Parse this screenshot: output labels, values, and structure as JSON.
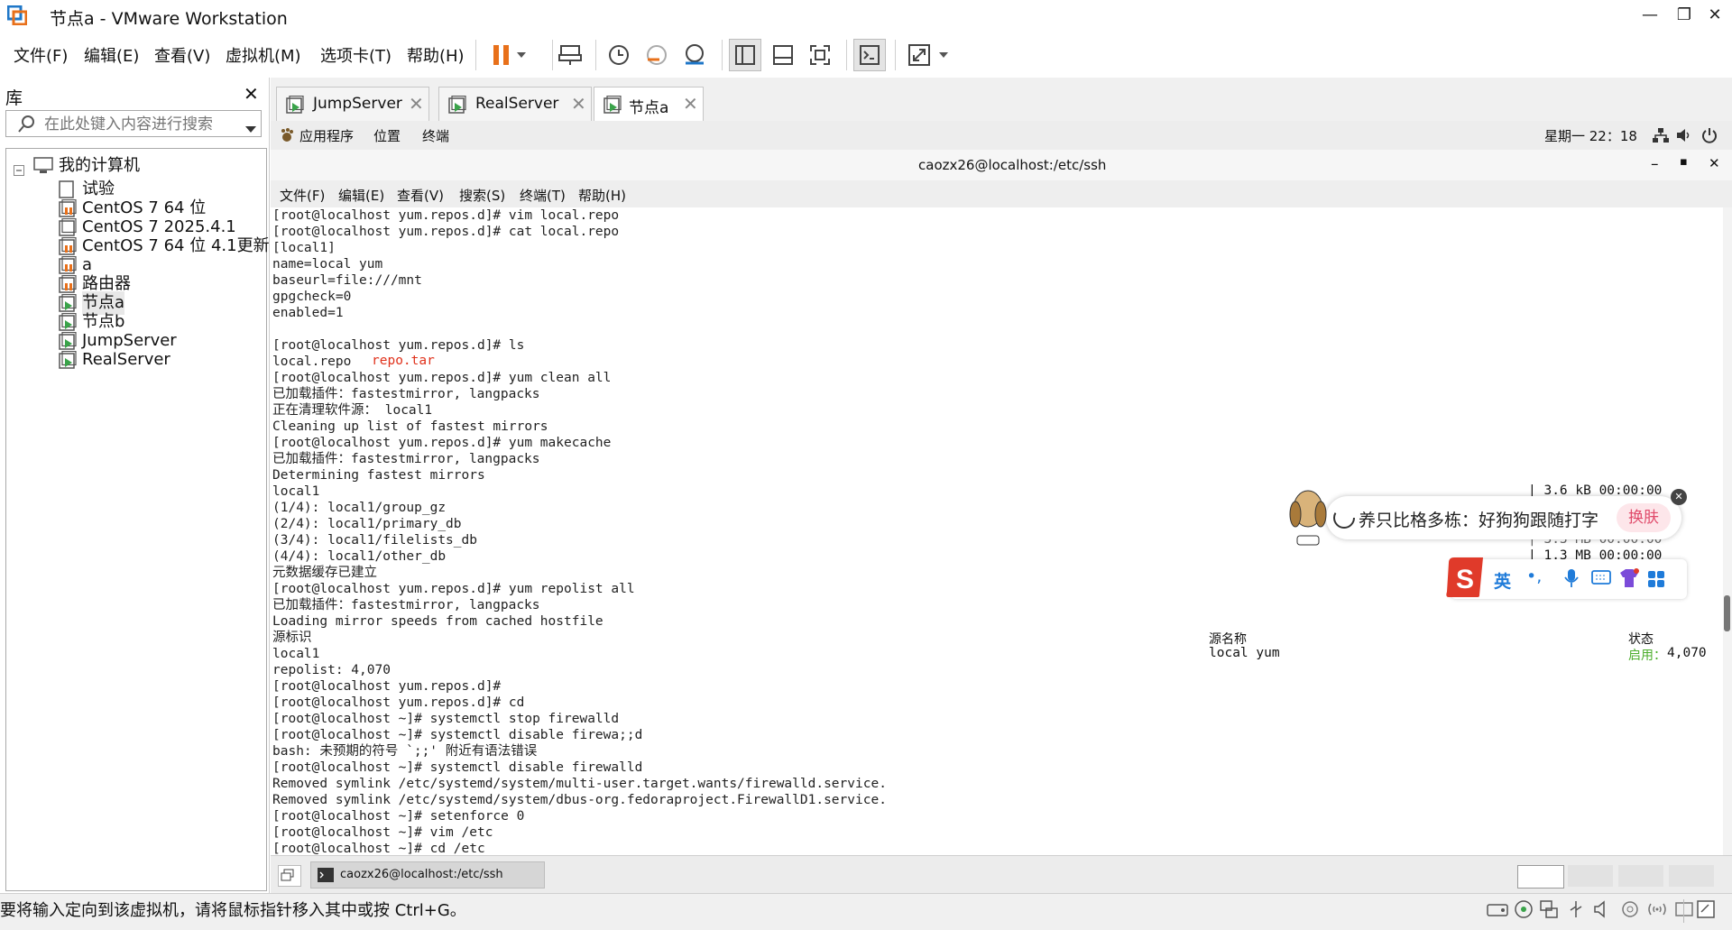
{
  "window": {
    "title": "节点a - VMware Workstation",
    "controls": [
      "—",
      "❐",
      "✕"
    ]
  },
  "menubar": {
    "items": [
      "文件(F)",
      "编辑(E)",
      "查看(V)",
      "虚拟机(M)",
      "选项卡(T)",
      "帮助(H)"
    ]
  },
  "library": {
    "title": "库",
    "close": "✕",
    "search_placeholder": "在此处键入内容进行搜索",
    "tree": {
      "root": "我的计算机",
      "items": [
        "试验",
        "CentOS 7 64 位",
        "CentOS 7 2025.4.1",
        "CentOS 7 64 位 4.1更新",
        "a",
        "路由器",
        "节点a",
        "节点b",
        "JumpServer",
        "RealServer"
      ]
    }
  },
  "tabs": [
    {
      "label": "JumpServer",
      "active": false
    },
    {
      "label": "RealServer",
      "active": false
    },
    {
      "label": "节点a",
      "active": true
    }
  ],
  "guest_topbar": {
    "apps": "应用程序",
    "places": "位置",
    "terminal": "终端",
    "clock": "星期一 22：18"
  },
  "terminal": {
    "title": "caozx26@localhost:/etc/ssh",
    "controls": [
      "–",
      "▪",
      "✕"
    ],
    "menu": [
      "文件(F)",
      "编辑(E)",
      "查看(V)",
      "搜索(S)",
      "终端(T)",
      "帮助(H)"
    ],
    "lines": [
      "[root@localhost yum.repos.d]# vim local.repo",
      "[root@localhost yum.repos.d]# cat local.repo",
      "[local1]",
      "name=local yum",
      "baseurl=file:///mnt",
      "gpgcheck=0",
      "enabled=1",
      "",
      "[root@localhost yum.repos.d]# ls",
      "local.repo",
      "[root@localhost yum.repos.d]# yum clean all",
      "已加载插件：fastestmirror, langpacks",
      "正在清理软件源： local1",
      "Cleaning up list of fastest mirrors",
      "[root@localhost yum.repos.d]# yum makecache",
      "已加载插件：fastestmirror, langpacks",
      "Determining fastest mirrors",
      "local1",
      "(1/4): local1/group_gz",
      "(2/4): local1/primary_db",
      "(3/4): local1/filelists_db",
      "(4/4): local1/other_db",
      "元数据缓存已建立",
      "[root@localhost yum.repos.d]# yum repolist all",
      "已加载插件：fastestmirror, langpacks",
      "Loading mirror speeds from cached hostfile",
      "源标识",
      "local1",
      "repolist: 4,070",
      "[root@localhost yum.repos.d]#",
      "[root@localhost yum.repos.d]# cd",
      "[root@localhost ~]# systemctl stop firewalld",
      "[root@localhost ~]# systemctl disable firewa;;d",
      "bash: 未预期的符号 `;;' 附近有语法错误",
      "[root@localhost ~]# systemctl disable firewalld",
      "Removed symlink /etc/systemd/system/multi-user.target.wants/firewalld.service.",
      "Removed symlink /etc/systemd/system/dbus-org.fedoraproject.FirewallD1.service.",
      "[root@localhost ~]# setenforce 0",
      "[root@localhost ~]# vim /etc",
      "[root@localhost ~]# cd /etc"
    ],
    "ls_extra": "repo.tar",
    "repo_name_header": "源名称",
    "repo_name_value": "local yum",
    "status_header": "状态",
    "status_label": "启用：",
    "status_value": "4,070",
    "size_1": "| 3.6 kB  00:00:00",
    "size_3": "|  3.3 MB  00:00:00",
    "size_4": "|  1.3 MB  00:00:00"
  },
  "guest_bottom": {
    "task_label": "caozx26@localhost:/etc/ssh"
  },
  "ime": {
    "message": "养只比格多栋：好狗狗跟随打字",
    "skin_button": "换肤",
    "lang": "英",
    "punct": "•,"
  },
  "status_bar": {
    "text": "要将输入定向到该虚拟机，请将鼠标指针移入其中或按 Ctrl+G。"
  },
  "colors": {
    "accent_orange": "#e8701a",
    "vm_green": "#3aa34a",
    "term_red": "#e0321c",
    "term_green": "#4cae2c",
    "sogou_red": "#e03a2a",
    "ime_blue": "#1f7bd9"
  }
}
